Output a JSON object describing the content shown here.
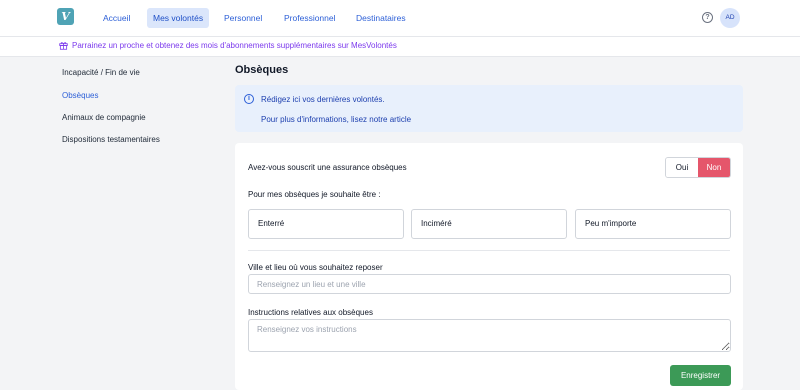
{
  "header": {
    "logo_letter": "V",
    "nav": [
      {
        "label": "Accueil",
        "active": false
      },
      {
        "label": "Mes volontés",
        "active": true
      },
      {
        "label": "Personnel",
        "active": false
      },
      {
        "label": "Professionnel",
        "active": false
      },
      {
        "label": "Destinataires",
        "active": false
      }
    ],
    "help_glyph": "?",
    "avatar_initials": "AD"
  },
  "promo": {
    "text": "Parrainez un proche et obtenez des mois d'abonnements supplémentaires sur MesVolontés"
  },
  "sidebar": {
    "items": [
      {
        "label": "Incapacité / Fin de vie",
        "active": false
      },
      {
        "label": "Obsèques",
        "active": true
      },
      {
        "label": "Animaux de compagnie",
        "active": false
      },
      {
        "label": "Dispositions testamentaires",
        "active": false
      }
    ]
  },
  "main": {
    "title": "Obsèques",
    "info": {
      "text": "Rédigez ici vos dernières volontés.",
      "link": "Pour plus d'informations, lisez notre article"
    },
    "form": {
      "insurance_question": "Avez-vous souscrit une assurance obsèques",
      "toggle": {
        "yes": "Oui",
        "no": "Non",
        "selected": "Non"
      },
      "wish_label": "Pour mes obsèques je souhaite être :",
      "choices": [
        "Enterré",
        "Inciméré",
        "Peu m'importe"
      ],
      "location_label": "Ville et lieu où vous souhaitez reposer",
      "location_placeholder": "Renseignez un lieu et une ville",
      "instructions_label": "Instructions relatives aux obsèques",
      "instructions_placeholder": "Renseignez vos instructions",
      "save_label": "Enregistrer"
    }
  },
  "colors": {
    "accent": "#2c5fd7",
    "promo": "#7c3aed",
    "danger": "#e5566b",
    "success": "#3c9a57"
  }
}
